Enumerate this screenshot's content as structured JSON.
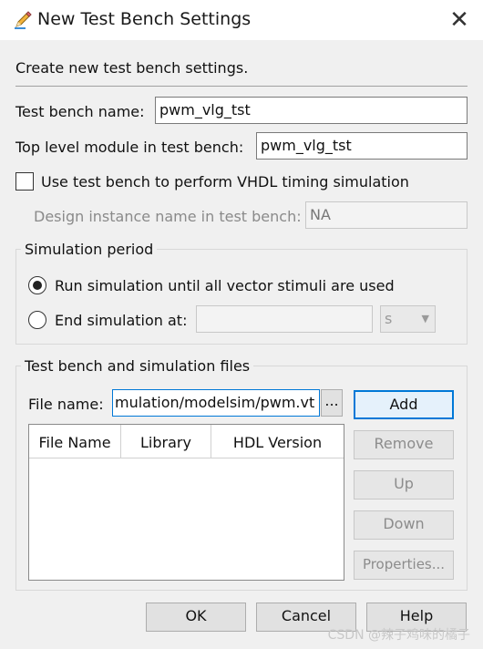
{
  "window": {
    "title": "New Test Bench Settings",
    "close_glyph": "✕",
    "app_icon": "pencil-icon"
  },
  "intro": "Create new test bench settings.",
  "test_bench_name": {
    "label": "Test bench name:",
    "value": "pwm_vlg_tst"
  },
  "top_level_module": {
    "label": "Top level module in test bench:",
    "value": "pwm_vlg_tst"
  },
  "vhdl_timing": {
    "label": "Use test bench to perform VHDL timing simulation",
    "checked": false
  },
  "design_instance": {
    "label": "Design instance name in test bench:",
    "value": "NA"
  },
  "simulation_period": {
    "title": "Simulation period",
    "run_all_label": "Run simulation until all vector stimuli are used",
    "run_all_selected": true,
    "end_at_label": "End simulation at:",
    "end_at_value": "",
    "unit": "s"
  },
  "files": {
    "title": "Test bench and simulation files",
    "file_name_label": "File name:",
    "file_name_value": "mulation/modelsim/pwm.vt",
    "browse_label": "...",
    "columns": [
      "File Name",
      "Library",
      "HDL Version"
    ],
    "buttons": {
      "add": "Add",
      "remove": "Remove",
      "up": "Up",
      "down": "Down",
      "properties": "Properties..."
    }
  },
  "footer": {
    "ok": "OK",
    "cancel": "Cancel",
    "help": "Help"
  },
  "watermark": "CSDN @辣子鸡味的橘子"
}
